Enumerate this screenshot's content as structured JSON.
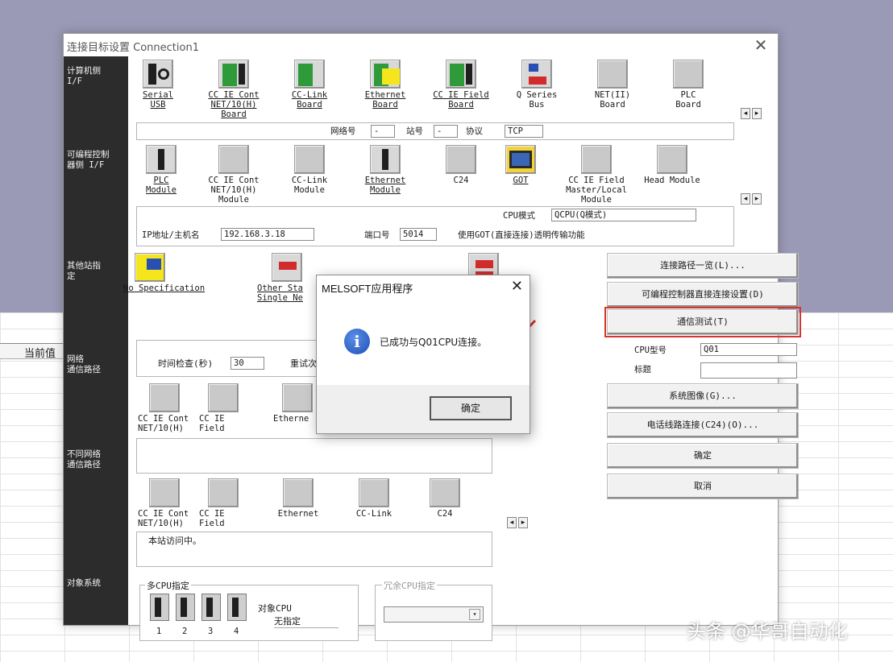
{
  "background": {
    "sheet_header": "当前值"
  },
  "window": {
    "title": "连接目标设置 Connection1"
  },
  "sidebar": {
    "pc_if": "计算机侧\nI/F",
    "plc_if": "可编程控制\n器侧 I/F",
    "other_station": "其他站指\n定",
    "network_route": "网络\n通信路径",
    "diff_network_route": "不同网络\n通信路径",
    "target_system": "对象系统"
  },
  "pc_if_devices": [
    {
      "label": "Serial\nUSB"
    },
    {
      "label": "CC IE Cont\nNET/10(H)\nBoard"
    },
    {
      "label": "CC-Link\nBoard"
    },
    {
      "label": "Ethernet\nBoard"
    },
    {
      "label": "CC IE Field\nBoard"
    },
    {
      "label": "Q Series\nBus"
    },
    {
      "label": "NET(II)\nBoard"
    },
    {
      "label": "PLC\nBoard"
    }
  ],
  "pc_if_info": {
    "network_label": "网络号",
    "network_value": "-",
    "station_label": "站号",
    "station_value": "-",
    "protocol_label": "协议",
    "protocol_value": "TCP"
  },
  "plc_if_devices": [
    {
      "label": "PLC\nModule"
    },
    {
      "label": "CC IE Cont\nNET/10(H)\nModule"
    },
    {
      "label": "CC-Link\nModule"
    },
    {
      "label": "Ethernet\nModule"
    },
    {
      "label": "C24"
    },
    {
      "label": "GOT"
    },
    {
      "label": "CC IE Field\nMaster/Local\nModule"
    },
    {
      "label": "Head Module"
    }
  ],
  "plc_if_info": {
    "cpu_mode_label": "CPU模式",
    "cpu_mode_value": "QCPU(Q模式)",
    "ip_label": "IP地址/主机名",
    "ip_value": "192.168.3.18",
    "port_label": "端口号",
    "port_value": "5014",
    "got_note": "使用GOT(直接连接)透明传输功能"
  },
  "other_station_devices": [
    {
      "label": "No Specification"
    },
    {
      "label": "Other Sta\nSingle Ne"
    }
  ],
  "timing": {
    "check_label": "时间检查(秒)",
    "check_value": "30",
    "retry_label": "重试次"
  },
  "network_route_devices": [
    {
      "label": "CC IE Cont\nNET/10(H)"
    },
    {
      "label": "CC IE\nField"
    },
    {
      "label": "Etherne"
    }
  ],
  "diff_route_devices": [
    {
      "label": "CC IE Cont\nNET/10(H)"
    },
    {
      "label": "CC IE\nField"
    },
    {
      "label": "Ethernet"
    },
    {
      "label": "CC-Link"
    },
    {
      "label": "C24"
    }
  ],
  "diff_route_note": "本站访问中。",
  "multi_cpu": {
    "title": "多CPU指定",
    "target_label": "对象CPU",
    "target_value": "无指定",
    "numbers": [
      "1",
      "2",
      "3",
      "4"
    ]
  },
  "redundant_cpu": {
    "title": "冗余CPU指定"
  },
  "buttons": {
    "route_list": "连接路径一览(L)...",
    "direct_connect": "可编程控制器直接连接设置(D)",
    "comm_test": "通信测试(T)",
    "system_image": "系统图像(G)...",
    "phone_line": "电话线路连接(C24)(O)...",
    "ok": "确定",
    "cancel": "取消"
  },
  "cpu_info": {
    "type_label": "CPU型号",
    "type_value": "Q01",
    "remark_label": "标题",
    "remark_value": ""
  },
  "dialog": {
    "title": "MELSOFT应用程序",
    "message": "已成功与Q01CPU连接。",
    "ok_label": "确定",
    "icon_glyph": "i"
  },
  "colors": {
    "highlight": "#d9342b",
    "sidebar": "#2c2c2c",
    "info_icon": "#1d4fb6"
  },
  "watermark": "头条 @华哥自动化"
}
